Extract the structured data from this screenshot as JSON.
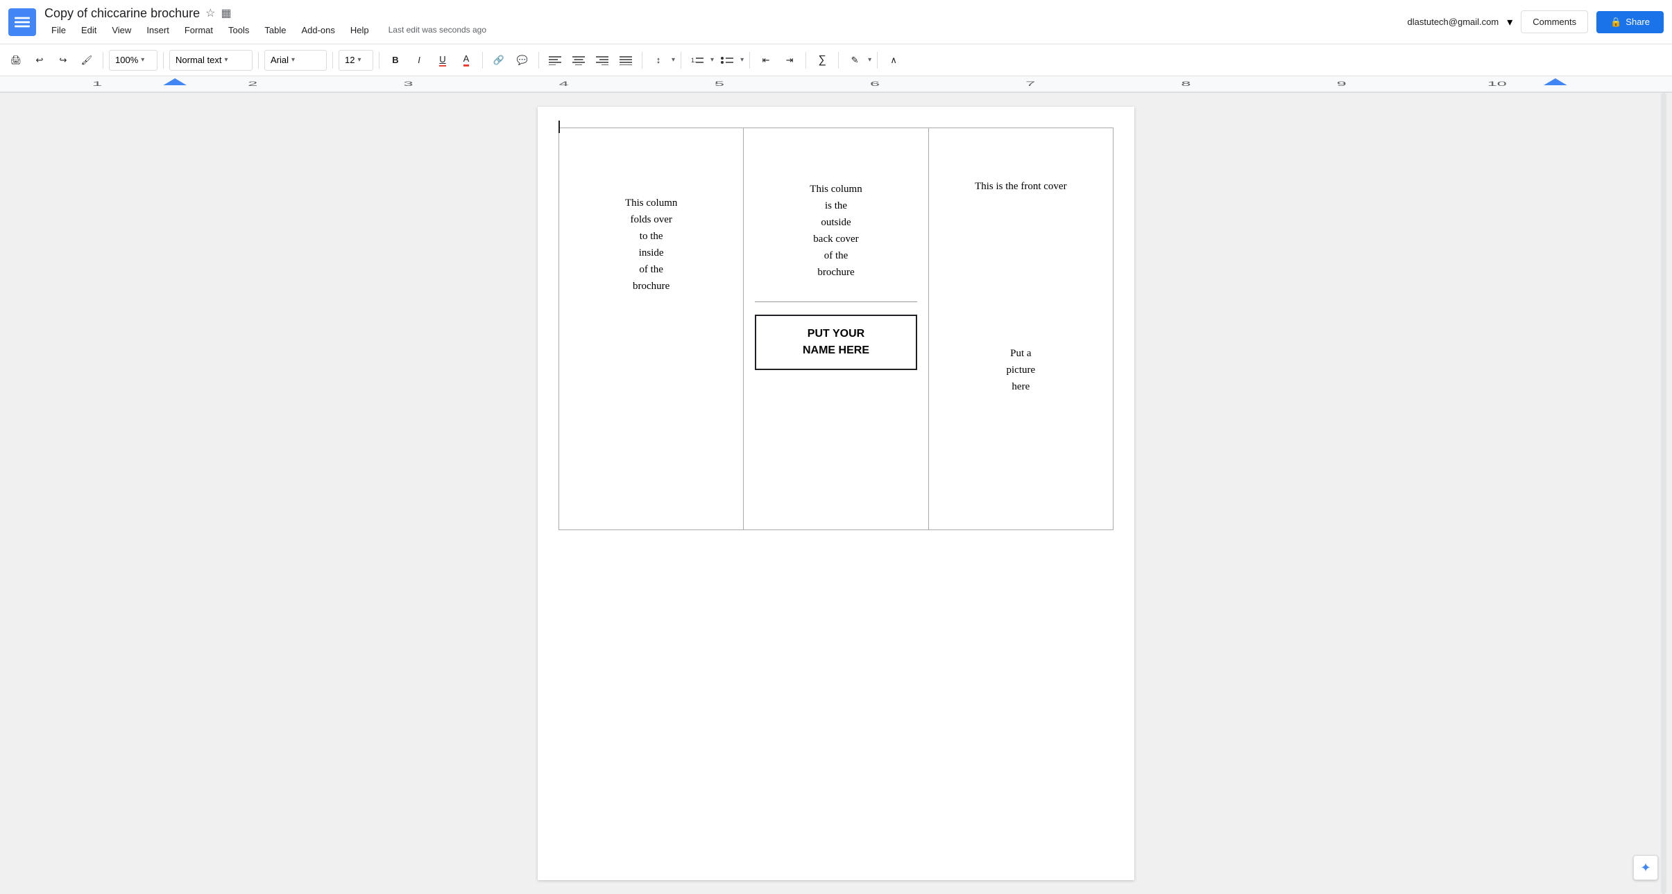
{
  "app": {
    "icon_label": "≡",
    "title": "Copy of chiccarine brochure",
    "star_icon": "☆",
    "folder_icon": "▦"
  },
  "menu": {
    "items": [
      "File",
      "Edit",
      "View",
      "Insert",
      "Format",
      "Tools",
      "Table",
      "Add-ons",
      "Help"
    ],
    "last_edit": "Last edit was seconds ago"
  },
  "top_right": {
    "user_email": "dlastutech@gmail.com",
    "chevron": "▾",
    "comments_label": "Comments",
    "share_label": "Share",
    "lock_icon": "🔒"
  },
  "toolbar": {
    "print_icon": "🖶",
    "undo_icon": "↩",
    "redo_icon": "↪",
    "paintformat_icon": "🖌",
    "zoom_value": "100%",
    "zoom_arrow": "▾",
    "style_value": "Normal text",
    "style_arrow": "▾",
    "font_value": "Arial",
    "font_arrow": "▾",
    "fontsize_value": "12",
    "fontsize_arrow": "▾",
    "bold_label": "B",
    "italic_label": "I",
    "underline_label": "U",
    "text_color_label": "A",
    "link_icon": "🔗",
    "comment_icon": "💬",
    "align_left": "≡",
    "align_center": "≡",
    "align_right": "≡",
    "align_justify": "≡",
    "line_spacing_icon": "↕",
    "numbered_list_icon": "≔",
    "bullet_list_icon": "⊟",
    "decrease_indent": "⇤",
    "increase_indent": "⇥",
    "formula_icon": "∑",
    "pen_icon": "✎",
    "collapse_icon": "∧"
  },
  "document": {
    "col1_text": "This column\nfolds over\nto the\ninside\nof the\nbrochure",
    "col2_top_text": "This column\nis the\noutside\nback cover\nof the\nbrochure",
    "col2_name_line1": "PUT YOUR",
    "col2_name_line2": "NAME HERE",
    "col3_front_cover": "This is the front cover",
    "col3_picture": "Put a\npicture\nhere"
  },
  "bottom_widget": {
    "icon": "✦"
  }
}
